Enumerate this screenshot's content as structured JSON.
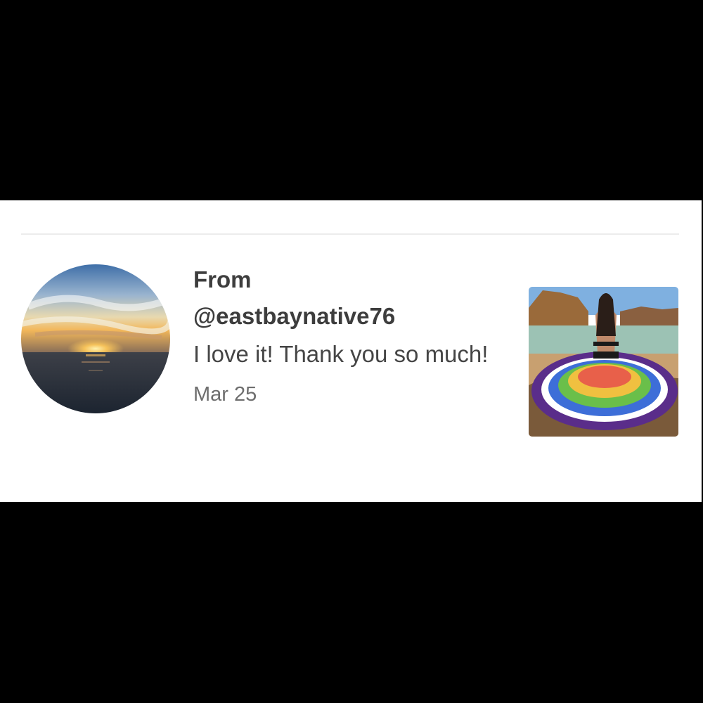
{
  "review": {
    "from_label": "From",
    "handle": "@eastbaynative76",
    "message": "I love it! Thank you so much!",
    "date": "Mar 25"
  },
  "colors": {
    "card_background": "#ffffff",
    "letterbox": "#000000",
    "primary_text": "#3d3d3d",
    "secondary_text": "#6e6e6e",
    "divider": "#ececec"
  },
  "icons": {
    "avatar": "sunset-over-ocean-avatar",
    "thumbnail": "beach-mandala-towel-photo"
  }
}
